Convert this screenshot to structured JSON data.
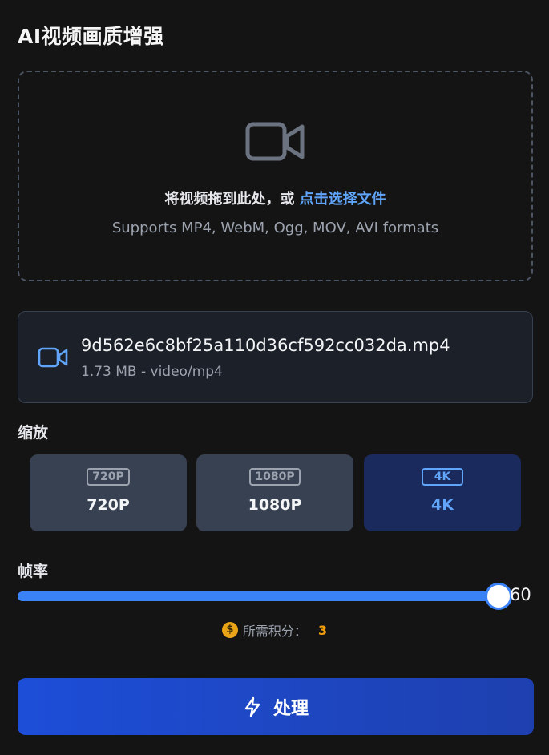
{
  "header": {
    "title": "AI视频画质增强"
  },
  "dropzone": {
    "prompt_prefix": "将视频拖到此处，或 ",
    "prompt_link": "点击选择文件",
    "formats": "Supports MP4, WebM, Ogg, MOV, AVI formats"
  },
  "file": {
    "name": "9d562e6c8bf25a110d36cf592cc032da.mp4",
    "meta": "1.73 MB - video/mp4"
  },
  "scale": {
    "label": "缩放",
    "options": [
      {
        "badge": "720P",
        "label": "720P"
      },
      {
        "badge": "1080P",
        "label": "1080P"
      },
      {
        "badge": "4K",
        "label": "4K"
      }
    ],
    "selected": "4K"
  },
  "fps": {
    "label": "帧率",
    "value": "60",
    "fraction": 1.0
  },
  "credits": {
    "icon": "$",
    "label": "所需积分：",
    "value": "3"
  },
  "process": {
    "label": "处理"
  },
  "colors": {
    "accent": "#3b82f6",
    "link": "#60a5fa",
    "coin": "#e8a317",
    "credit_value": "#f59e0b"
  }
}
